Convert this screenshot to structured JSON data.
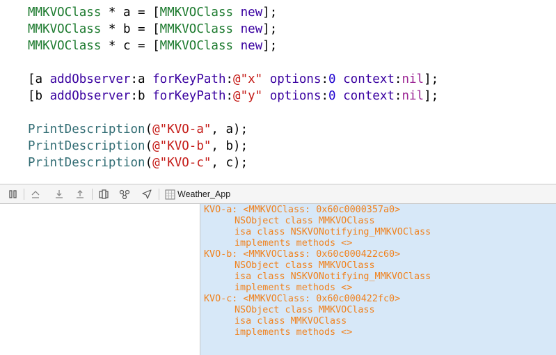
{
  "editor": {
    "lines": [
      {
        "parts": [
          {
            "t": "MMKVOClass",
            "c": "cls2"
          },
          {
            "t": " * a = ["
          },
          {
            "t": "MMKVOClass",
            "c": "cls2"
          },
          {
            "t": " "
          },
          {
            "t": "new",
            "c": "sel"
          },
          {
            "t": "];"
          }
        ]
      },
      {
        "parts": [
          {
            "t": "MMKVOClass",
            "c": "cls2"
          },
          {
            "t": " * b = ["
          },
          {
            "t": "MMKVOClass",
            "c": "cls2"
          },
          {
            "t": " "
          },
          {
            "t": "new",
            "c": "sel"
          },
          {
            "t": "];"
          }
        ]
      },
      {
        "parts": [
          {
            "t": "MMKVOClass",
            "c": "cls2"
          },
          {
            "t": " * c = ["
          },
          {
            "t": "MMKVOClass",
            "c": "cls2"
          },
          {
            "t": " "
          },
          {
            "t": "new",
            "c": "sel"
          },
          {
            "t": "];"
          }
        ]
      },
      {
        "parts": []
      },
      {
        "parts": [
          {
            "t": "[a "
          },
          {
            "t": "addObserver",
            "c": "sel"
          },
          {
            "t": ":a "
          },
          {
            "t": "forKeyPath",
            "c": "sel"
          },
          {
            "t": ":"
          },
          {
            "t": "@\"x\"",
            "c": "str"
          },
          {
            "t": " "
          },
          {
            "t": "options",
            "c": "sel"
          },
          {
            "t": ":"
          },
          {
            "t": "0",
            "c": "num"
          },
          {
            "t": " "
          },
          {
            "t": "context",
            "c": "sel"
          },
          {
            "t": ":"
          },
          {
            "t": "nil",
            "c": "kw"
          },
          {
            "t": "];"
          }
        ]
      },
      {
        "parts": [
          {
            "t": "[b "
          },
          {
            "t": "addObserver",
            "c": "sel"
          },
          {
            "t": ":b "
          },
          {
            "t": "forKeyPath",
            "c": "sel"
          },
          {
            "t": ":"
          },
          {
            "t": "@\"y\"",
            "c": "str"
          },
          {
            "t": " "
          },
          {
            "t": "options",
            "c": "sel"
          },
          {
            "t": ":"
          },
          {
            "t": "0",
            "c": "num"
          },
          {
            "t": " "
          },
          {
            "t": "context",
            "c": "sel"
          },
          {
            "t": ":"
          },
          {
            "t": "nil",
            "c": "kw"
          },
          {
            "t": "];"
          }
        ]
      },
      {
        "parts": []
      },
      {
        "parts": [
          {
            "t": "PrintDescription",
            "c": "fn"
          },
          {
            "t": "("
          },
          {
            "t": "@\"KVO-a\"",
            "c": "str"
          },
          {
            "t": ", a);"
          }
        ]
      },
      {
        "parts": [
          {
            "t": "PrintDescription",
            "c": "fn"
          },
          {
            "t": "("
          },
          {
            "t": "@\"KVO-b\"",
            "c": "str"
          },
          {
            "t": ", b);"
          }
        ]
      },
      {
        "parts": [
          {
            "t": "PrintDescription",
            "c": "fn"
          },
          {
            "t": "("
          },
          {
            "t": "@\"KVO-c\"",
            "c": "str"
          },
          {
            "t": ", c);"
          }
        ]
      }
    ]
  },
  "toolbar": {
    "target_name": "Weather_App",
    "icons": [
      "hide-debug-area-icon",
      "continue-icon",
      "step-over-icon",
      "step-into-icon",
      "step-out-icon",
      "view-hierarchy-icon",
      "memory-graph-icon",
      "simulate-location-icon",
      "target-app-icon"
    ]
  },
  "console": {
    "lines": [
      {
        "text": "KVO-a: <MMKVOClass: 0x60c0000357a0>",
        "indent": false
      },
      {
        "text": "NSObject class MMKVOClass",
        "indent": true
      },
      {
        "text": "isa class NSKVONotifying_MMKVOClass",
        "indent": true
      },
      {
        "text": "implements methods <>",
        "indent": true
      },
      {
        "text": "KVO-b: <MMKVOClass: 0x60c000422c60>",
        "indent": false
      },
      {
        "text": "NSObject class MMKVOClass",
        "indent": true
      },
      {
        "text": "isa class NSKVONotifying_MMKVOClass",
        "indent": true
      },
      {
        "text": "implements methods <>",
        "indent": true
      },
      {
        "text": "KVO-c: <MMKVOClass: 0x60c000422fc0>",
        "indent": false
      },
      {
        "text": "NSObject class MMKVOClass",
        "indent": true
      },
      {
        "text": "isa class MMKVOClass",
        "indent": true
      },
      {
        "text": "implements methods <>",
        "indent": true
      }
    ],
    "colors": {
      "output": "#f0821e",
      "background": "#d7e8f8"
    }
  }
}
